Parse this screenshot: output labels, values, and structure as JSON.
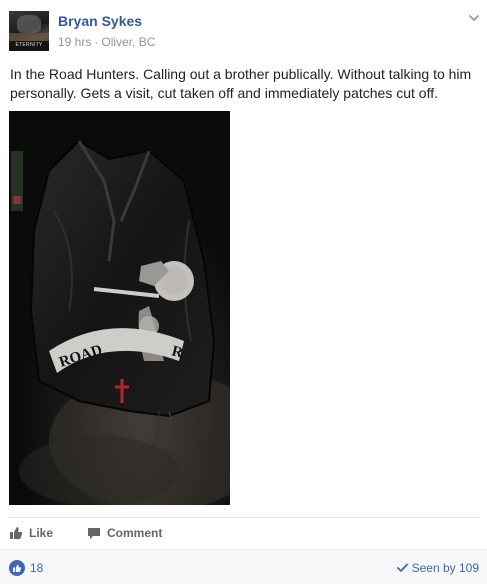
{
  "post": {
    "author": "Bryan Sykes",
    "time": "19 hrs",
    "separator": "·",
    "location": "Oliver, BC",
    "text": "In the Road Hunters. Calling out a brother publically. Without talking to him personally. Gets a visit, cut taken off and immediately patches cut off.",
    "avatar_caption": "ETERNITY",
    "photo": {
      "description_icon": "leather-vest-photo",
      "patch_text": "ROAD H    ER"
    }
  },
  "actions": {
    "like_label": "Like",
    "comment_label": "Comment"
  },
  "footer": {
    "like_count": "18",
    "seen_label": "Seen by 109"
  },
  "colors": {
    "link_blue": "#365899",
    "facebook_blue": "#4267b2",
    "meta_gray": "#90949c",
    "action_gray": "#606770",
    "footer_bg": "#f6f7f9"
  }
}
